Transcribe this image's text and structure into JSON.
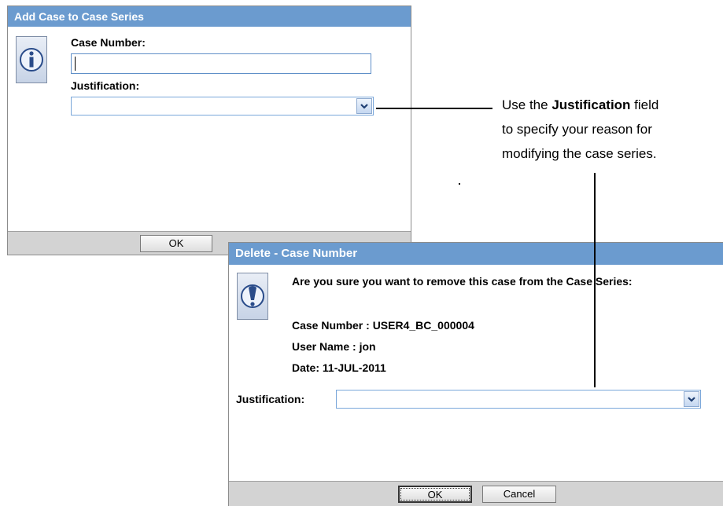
{
  "add_dialog": {
    "title": "Add Case to Case Series",
    "case_number_label": "Case Number:",
    "case_number_value": "",
    "justification_label": "Justification:",
    "justification_value": "",
    "ok_label": "OK",
    "icon": "info-icon"
  },
  "annotation": {
    "prefix": "Use the ",
    "emphasis": "Justification",
    "suffix": " field",
    "line2": "to specify your reason for",
    "line3": "modifying the case series."
  },
  "delete_dialog": {
    "title": "Delete - Case Number",
    "question": "Are you sure you want to remove this case from the Case Series:",
    "case_number": "Case Number :  USER4_BC_000004",
    "user_name": "User Name : jon",
    "date": "Date: 11-JUL-2011",
    "justification_label": "Justification:",
    "justification_value": "",
    "ok_label": "OK",
    "cancel_label": "Cancel",
    "icon": "exclamation-icon"
  },
  "colors": {
    "title_bar": "#6b9bcf",
    "footer": "#d3d3d3",
    "field_border": "#7aa7da"
  }
}
